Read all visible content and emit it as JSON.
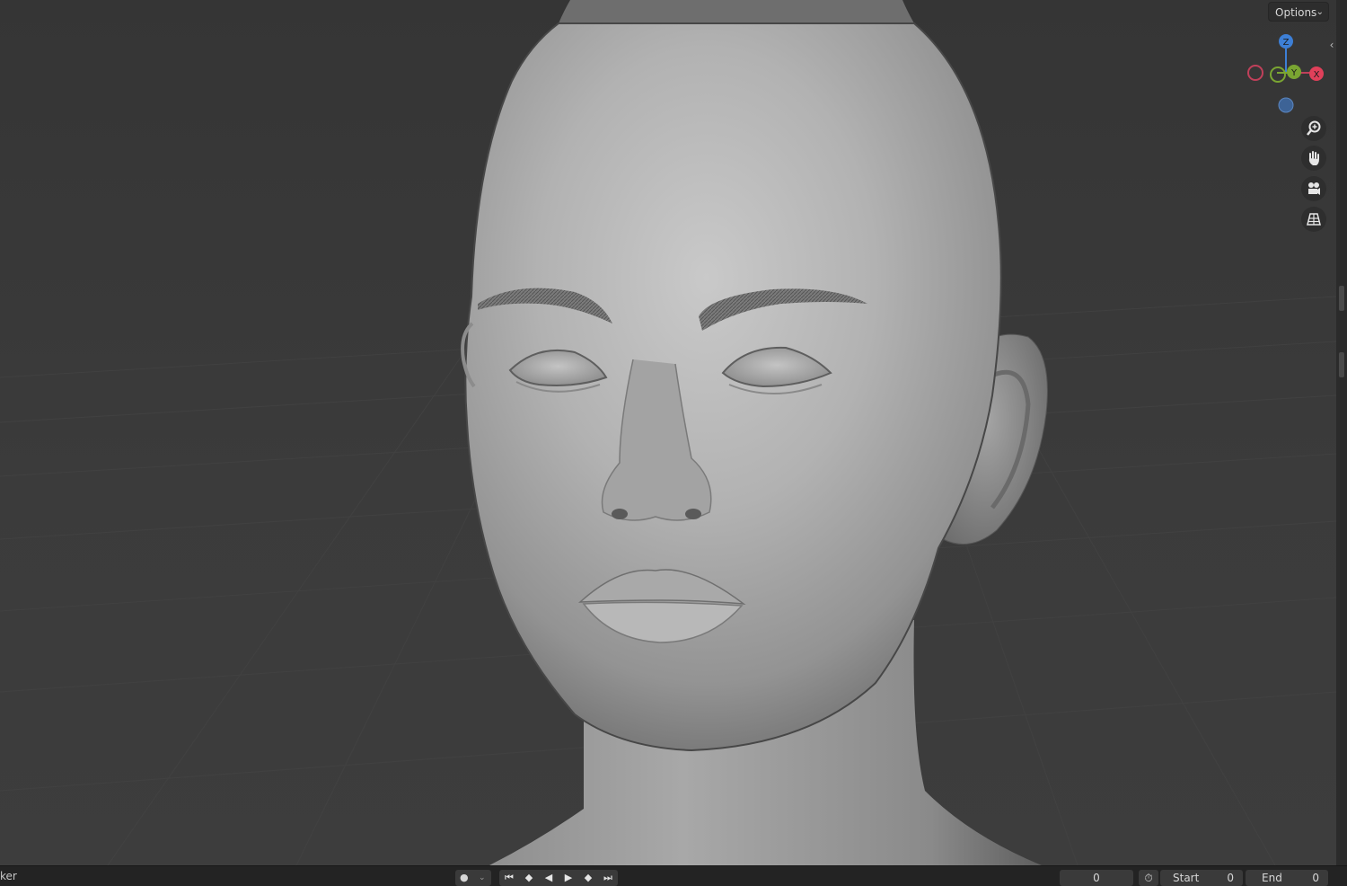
{
  "viewport": {
    "options_label": "Options",
    "sidebar_toggle_icon": "chevron-left-icon",
    "gizmo": {
      "z_label": "Z",
      "y_label": "Y",
      "x_label": "X",
      "colors": {
        "x": "#e0405a",
        "y": "#7aa532",
        "z": "#3d7fd6"
      }
    },
    "nav_buttons": [
      {
        "name": "zoom-icon"
      },
      {
        "name": "hand-pan-icon"
      },
      {
        "name": "camera-icon"
      },
      {
        "name": "perspective-grid-icon"
      }
    ]
  },
  "timeline": {
    "editor_label": "ker",
    "current_frame": "0",
    "start_label": "Start",
    "start_value": "0",
    "end_label": "End",
    "end_value": "0"
  }
}
